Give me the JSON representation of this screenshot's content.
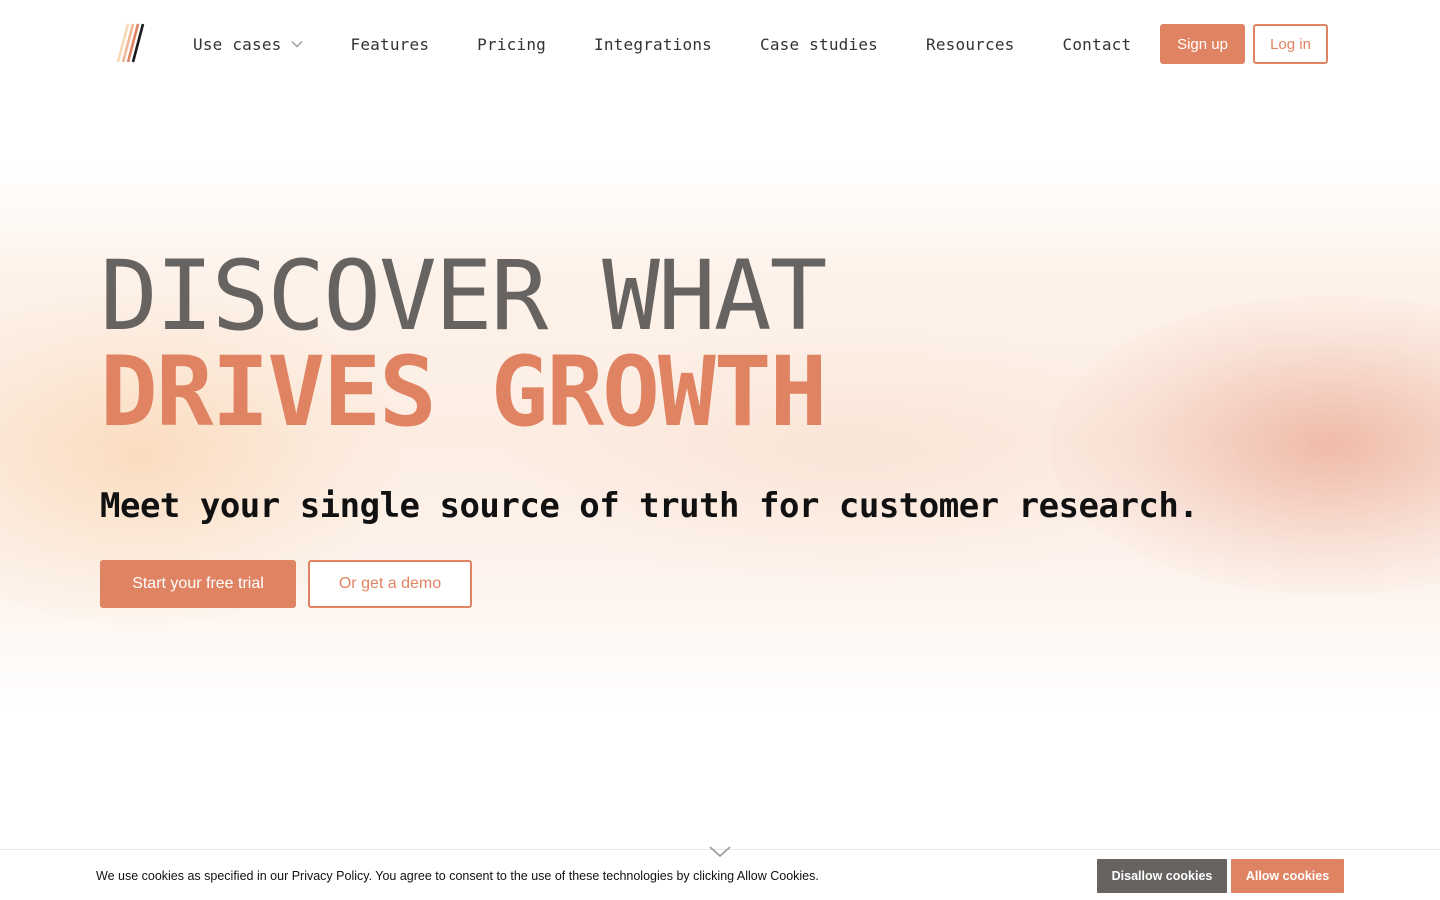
{
  "colors": {
    "accent": "#e08362",
    "heading_gray": "#666361",
    "disallow_bg": "#666361"
  },
  "header": {
    "logo_icon": "slash-stripes-logo",
    "nav": [
      {
        "label": "Use cases",
        "has_dropdown": true
      },
      {
        "label": "Features"
      },
      {
        "label": "Pricing"
      },
      {
        "label": "Integrations"
      },
      {
        "label": "Case studies"
      },
      {
        "label": "Resources"
      },
      {
        "label": "Contact"
      }
    ],
    "signup_label": "Sign up",
    "login_label": "Log in"
  },
  "hero": {
    "headline_line1": "DISCOVER WHAT",
    "headline_line2": "DRIVES GROWTH",
    "subheadline": "Meet your single source of truth for customer research.",
    "primary_cta": "Start your free trial",
    "secondary_cta": "Or get a demo",
    "scroll_icon": "chevron-down-icon"
  },
  "cookie_banner": {
    "text": "We use cookies as specified in our Privacy Policy. You agree to consent to the use of these technologies by clicking Allow Cookies.",
    "disallow_label": "Disallow cookies",
    "allow_label": "Allow cookies"
  }
}
